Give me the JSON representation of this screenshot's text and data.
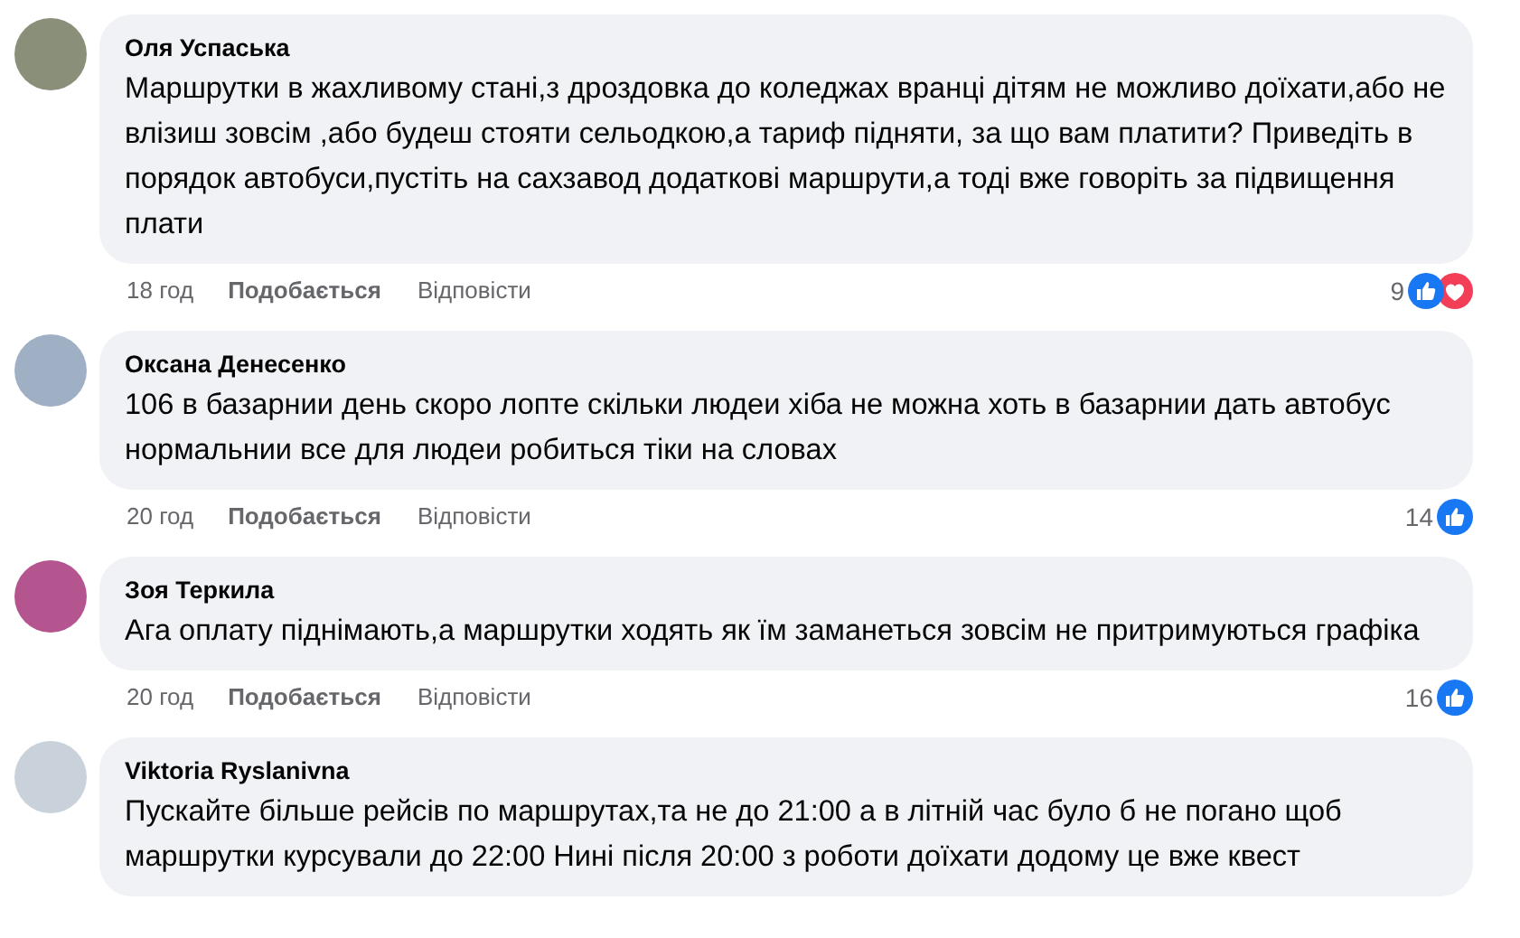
{
  "comments": [
    {
      "author": "Оля Успаська",
      "text": "Маршрутки в жахливому стані,з дроздовка до коледжах вранці дітям не можливо доїхати,або не влізиш зовсім ,або будеш стояти сельодкою,а тариф підняти, за що вам платити? Приведіть в порядок автобуси,пустіть на сахзавод додаткові маршрути,а тоді вже говоріть за підвищення плати",
      "time": "18 год",
      "like_label": "Подобається",
      "reply_label": "Відповісти",
      "reaction_count": "9",
      "reactions": [
        {
          "kind": "like"
        },
        {
          "kind": "love"
        }
      ]
    },
    {
      "author": "Оксана Денесенко",
      "text": "106 в базарнии день скоро лопте скільки людеи хіба не можна хоть в базарнии дать автобус нормальнии все для людеи робиться тіки на словах",
      "time": "20 год",
      "like_label": "Подобається",
      "reply_label": "Відповісти",
      "reaction_count": "14",
      "reactions": [
        {
          "kind": "like"
        }
      ]
    },
    {
      "author": "Зоя Теркила",
      "text": "Ага оплату піднімають,а маршрутки ходять як їм заманеться зовсім не притримуються графіка",
      "time": "20 год",
      "like_label": "Подобається",
      "reply_label": "Відповісти",
      "reaction_count": "16",
      "reactions": [
        {
          "kind": "like"
        }
      ]
    },
    {
      "author": "Viktoria Ryslanivna",
      "text": "Пускайте більше рейсів по маршрутах,та не до 21:00 а в літній час було б не погано щоб маршрутки курсували до 22:00 Нині після 20:00 з роботи доїхати додому це вже квест"
    }
  ]
}
